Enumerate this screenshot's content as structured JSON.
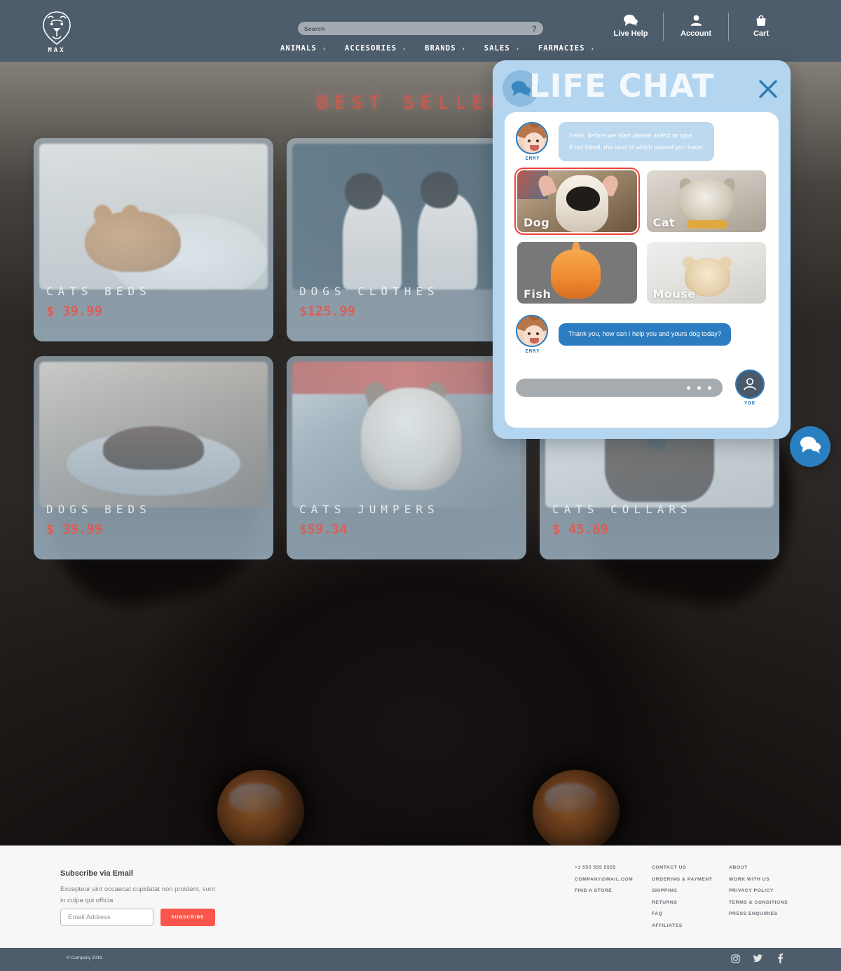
{
  "header": {
    "logo_text": "MAX",
    "logo_icon": "dog-head-icon",
    "search": {
      "placeholder": "Search",
      "value": "",
      "help_glyph": "?"
    },
    "nav": [
      {
        "label": "ANIMALS",
        "chevron": "›"
      },
      {
        "label": "ACCESORIES",
        "chevron": "›"
      },
      {
        "label": "BRANDS",
        "chevron": "›"
      },
      {
        "label": "SALES",
        "chevron": "›"
      },
      {
        "label": "FARMACIES",
        "chevron": "›"
      }
    ],
    "utilities": [
      {
        "label": "Live Help",
        "icon": "chat-bubble-icon"
      },
      {
        "label": "Account",
        "icon": "person-icon"
      },
      {
        "label": "Cart",
        "icon": "shopping-bag-icon"
      }
    ]
  },
  "main": {
    "section_title": "BEST SELLERS",
    "products": [
      {
        "title": "CATS BEDS",
        "price": "$ 39.99"
      },
      {
        "title": "DOGS CLOTHES",
        "price": "$125.99"
      },
      {
        "title": "",
        "price": ""
      },
      {
        "title": "DOGS BEDS",
        "price": "$ 39.99"
      },
      {
        "title": "CATS JUMPERS",
        "price": "$59.34"
      },
      {
        "title": "CATS COLLARS",
        "price": "$ 45.69"
      }
    ]
  },
  "chat": {
    "title": "LIFE CHAT",
    "badge_icon": "chat-bubbles-icon",
    "close_icon": "close-x-icon",
    "agent_name": "EMMY",
    "message_1": "Hello, before we start please select or type if not listed, the kind of which animal you have:",
    "message_1_line1": "Hello, before we start please select or type",
    "message_1_line2": "if not listed, the kind of which animal you have:",
    "message_2": "Thank you, how can I help you and yours dog today?",
    "animals": [
      {
        "label": "Dog",
        "selected": true
      },
      {
        "label": "Cat",
        "selected": false
      },
      {
        "label": "Fish",
        "selected": false
      },
      {
        "label": "Mouse",
        "selected": false
      }
    ],
    "input": {
      "placeholder": "",
      "value": "",
      "typing_dots": 3
    },
    "user_name": "YOU",
    "user_icon": "person-icon",
    "fab_icon": "chat-bubbles-icon"
  },
  "footer": {
    "subscribe_title": "Subscribe via Email",
    "subscribe_desc": "Excepteur sint occaecat cupidatat non proident, sunt in culpa qui officia",
    "email_placeholder": "Email Address",
    "subscribe_button": "SUBSCRIBE",
    "columns": [
      {
        "links": [
          "+1 555 555 5555",
          "COMPANY@MAIL.COM",
          "FIND A STORE"
        ]
      },
      {
        "links": [
          "CONTACT US",
          "ORDERING & PAYMENT",
          "SHIPPING",
          "RETURNS",
          "FAQ",
          "AFFILIATES"
        ]
      },
      {
        "links": [
          "ABOUT",
          "WORK WITH US",
          "PRIVACY POLICY",
          "TERMS & CONDITIONS",
          "PRESS ENQUIRIES"
        ]
      }
    ],
    "copyright": "© Company 2019",
    "socials": [
      "instagram-icon",
      "twitter-icon",
      "facebook-icon"
    ]
  },
  "colors": {
    "header_bg": "#4e5d6b",
    "accent_red": "#f9554b",
    "price_red": "#e15b50",
    "chat_panel": "#b4d5ef",
    "chat_blue": "#2b7cc0",
    "selected_outline": "#ef4136",
    "footer_bg": "#f7f7f7"
  }
}
